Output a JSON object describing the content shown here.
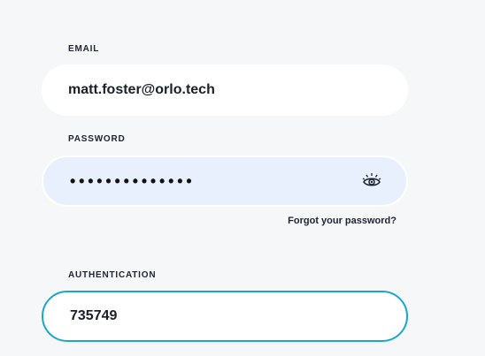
{
  "email": {
    "label": "EMAIL",
    "value": "matt.foster@orlo.tech"
  },
  "password": {
    "label": "PASSWORD",
    "masked_value": "••••••••••••••",
    "toggle_icon": "eye-icon"
  },
  "forgot_password": {
    "label": "Forgot your password?"
  },
  "authentication": {
    "label": "AUTHENTICATION",
    "value": "735749"
  },
  "colors": {
    "background": "#f6f7f9",
    "password_field_bg": "#e8f0fe",
    "focus_border": "#1aa7c9"
  }
}
